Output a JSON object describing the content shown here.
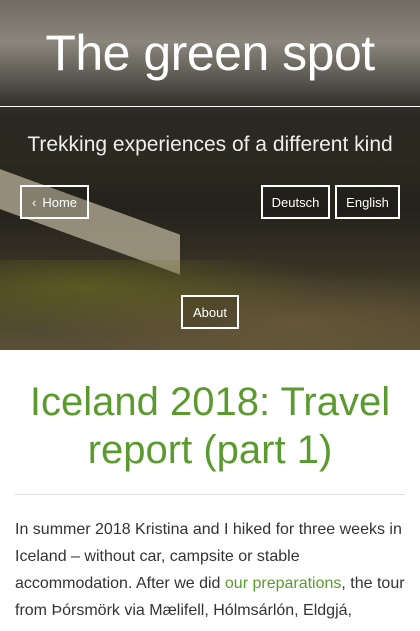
{
  "site": {
    "title": "The green spot",
    "tagline": "Trekking experiences of a different kind"
  },
  "nav": {
    "home": "Home",
    "deutsch": "Deutsch",
    "english": "English",
    "about": "About"
  },
  "article": {
    "title": "Iceland 2018: Travel report (part 1)",
    "p1_before": "In summer 2018 Kristina and I hiked for three weeks in Iceland – without car, campsite or stable accommodation. After we did ",
    "p1_link": "our preparations",
    "p1_after": ", the tour from Þórsmörk via Mælifell, Hólmsárlón, Eldgjá,"
  },
  "colors": {
    "accent": "#5a9a2f"
  }
}
